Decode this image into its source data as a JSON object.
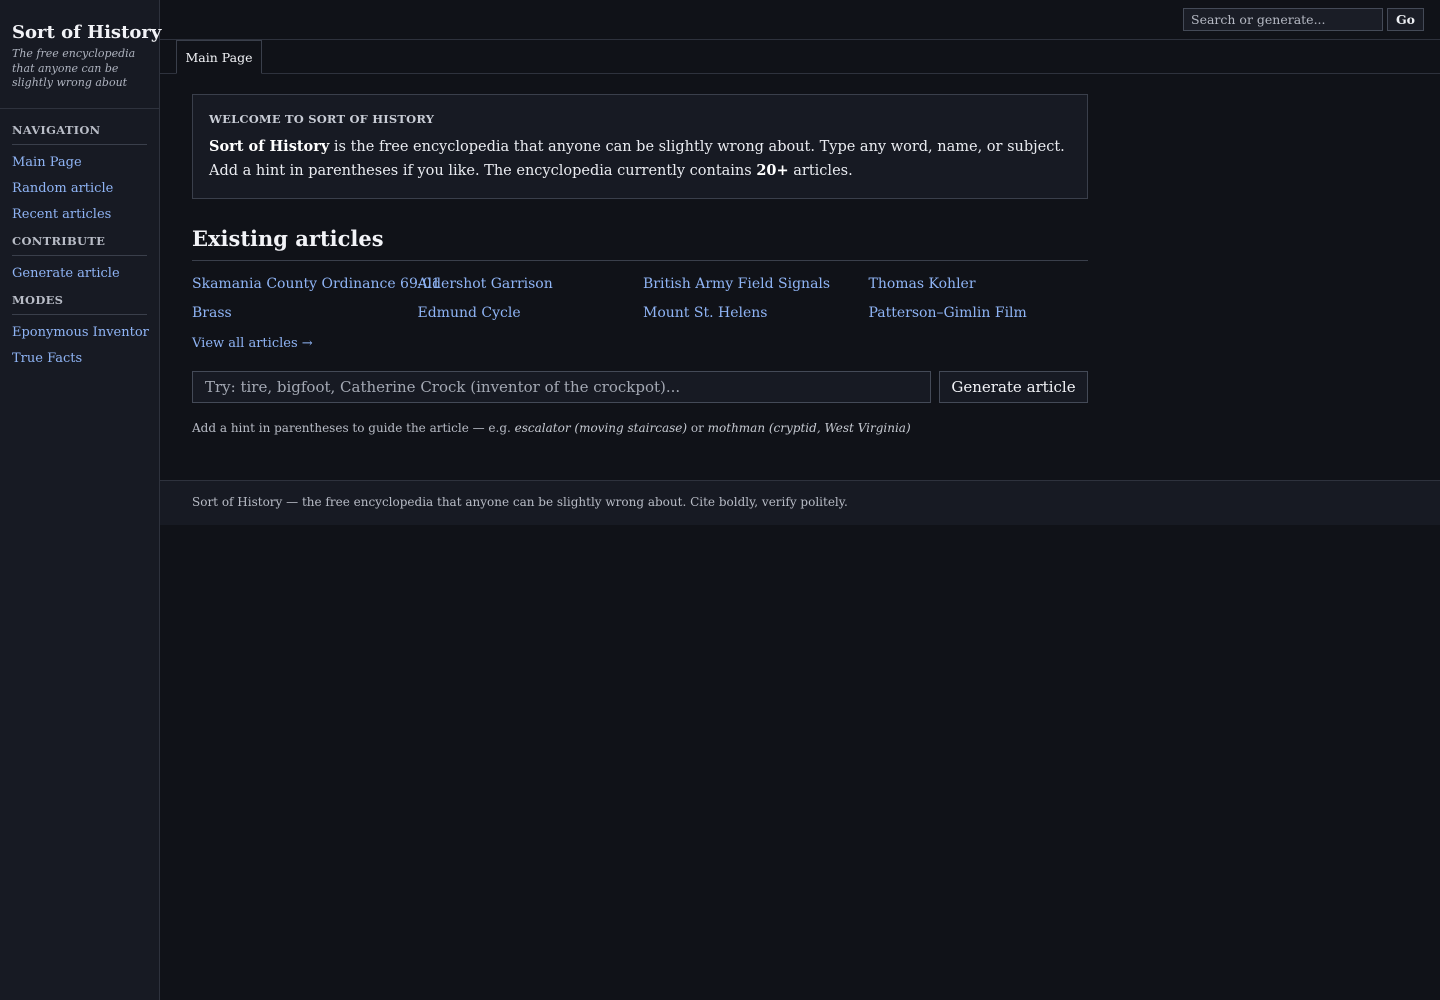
{
  "site": {
    "title": "Sort of History",
    "tagline": "The free encyclopedia that anyone can be slightly wrong about"
  },
  "sidebar": {
    "sections": [
      {
        "heading": "NAVIGATION",
        "items": [
          "Main Page",
          "Random article",
          "Recent articles"
        ]
      },
      {
        "heading": "CONTRIBUTE",
        "items": [
          "Generate article"
        ]
      },
      {
        "heading": "MODES",
        "items": [
          "Eponymous Inventor",
          "True Facts"
        ]
      }
    ]
  },
  "topbar": {
    "search_placeholder": "Search or generate...",
    "go_label": "Go"
  },
  "tabs": [
    "Main Page"
  ],
  "welcome": {
    "heading": "WELCOME TO SORT OF HISTORY",
    "brand_bold": "Sort of History",
    "text_1": " is the free encyclopedia that anyone can be slightly wrong about. Type any word, name, or subject. Add a hint in parentheses if you like. The encyclopedia currently contains ",
    "count_bold": "20+",
    "text_2": " articles."
  },
  "existing": {
    "title": "Existing articles",
    "articles": [
      "Skamania County Ordinance 69-01",
      "Aldershot Garrison",
      "British Army Field Signals",
      "Thomas Kohler",
      "Brass",
      "Edmund Cycle",
      "Mount St. Helens",
      "Patterson–Gimlin Film"
    ],
    "view_all": "View all articles →"
  },
  "generate": {
    "placeholder": "Try: tire, bigfoot, Catherine Crock (inventor of the crockpot)...",
    "button_label": "Generate article",
    "hint_prefix": "Add a hint in parentheses to guide the article — e.g. ",
    "hint_example_1": "escalator (moving staircase)",
    "hint_or": " or ",
    "hint_example_2": "mothman (cryptid, West Virginia)"
  },
  "footer": {
    "text": "Sort of History — the free encyclopedia that anyone can be slightly wrong about. Cite boldly, verify politely."
  },
  "colors": {
    "background": "#101218",
    "panel": "#171a23",
    "link": "#8fb4f5",
    "border": "#3a3f4b"
  }
}
